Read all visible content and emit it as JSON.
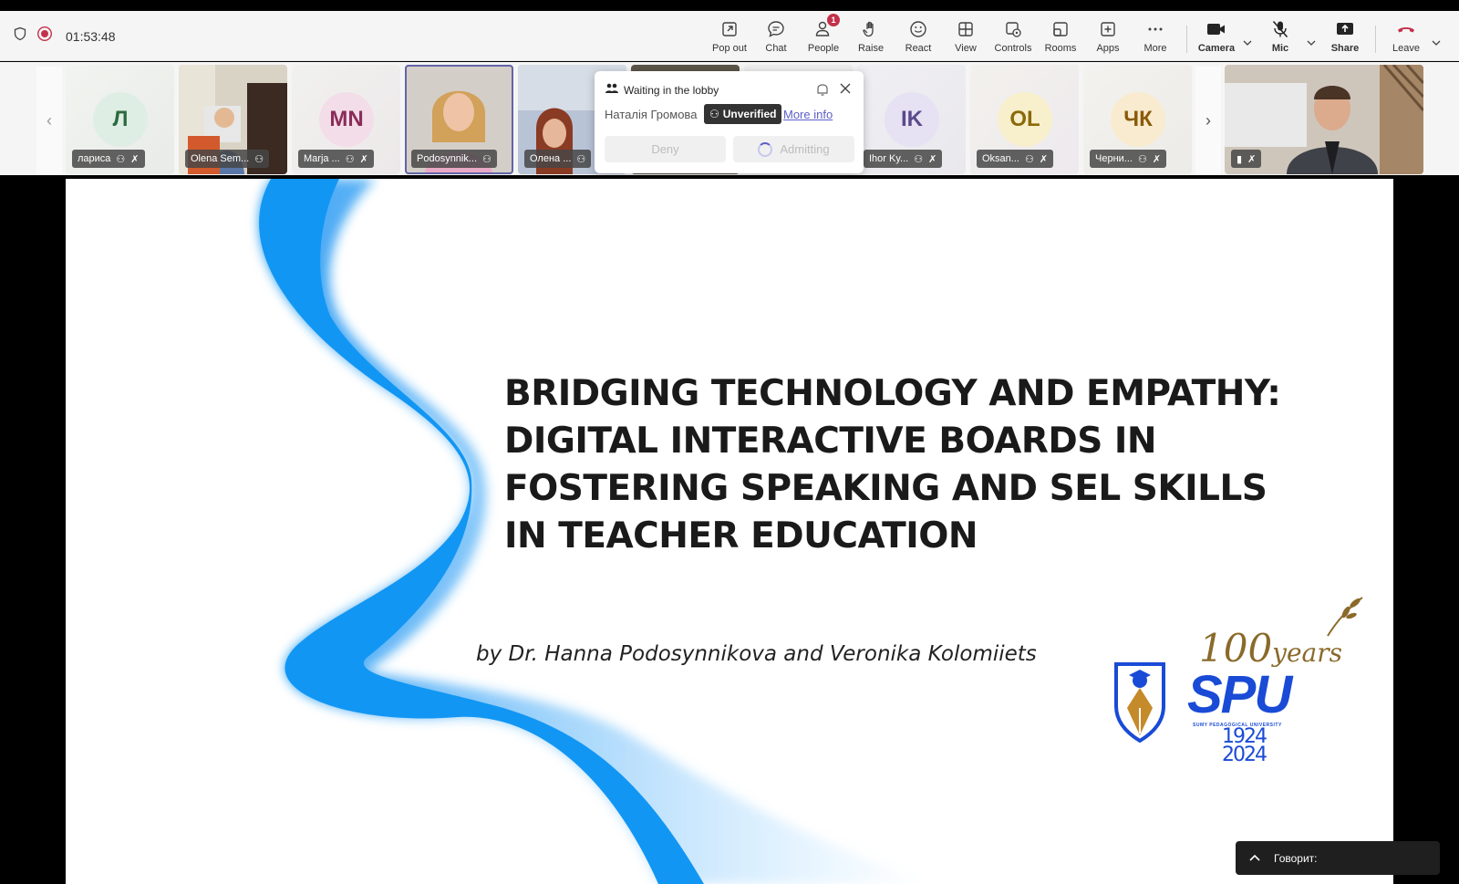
{
  "meeting": {
    "timer": "01:53:48"
  },
  "toolbar": {
    "popout": "Pop out",
    "chat": "Chat",
    "people": "People",
    "people_badge": "1",
    "raise": "Raise",
    "react": "React",
    "view": "View",
    "controls": "Controls",
    "rooms": "Rooms",
    "apps": "Apps",
    "more": "More",
    "camera": "Camera",
    "mic": "Mic",
    "share": "Share",
    "leave": "Leave"
  },
  "participants": [
    {
      "initials": "Л",
      "name": "лариса",
      "avatar_bg": "#dfeee4",
      "avatar_fg": "#2b6a3f"
    },
    {
      "name": "Olena Sem..."
    },
    {
      "initials": "MN",
      "name": "Marja ...",
      "avatar_bg": "#f3dde8",
      "avatar_fg": "#8a2d59"
    },
    {
      "name": "Podosynnik..."
    },
    {
      "name": "Олена ..."
    },
    {
      "initials": "IK",
      "name": "Ihor Ky...",
      "avatar_bg": "#e6e1f3",
      "avatar_fg": "#5a4a8a"
    },
    {
      "initials": "OL",
      "name": "Oksan...",
      "avatar_bg": "#f8efcc",
      "avatar_fg": "#8a6a0a"
    },
    {
      "initials": "ЧК",
      "name": "Черни...",
      "avatar_bg": "#f8ebcf",
      "avatar_fg": "#8a5a0a"
    }
  ],
  "lobby": {
    "title": "Waiting in the lobby",
    "name": "Наталія Громова",
    "badge": "Unverified",
    "more_info": "More info",
    "deny": "Deny",
    "admitting": "Admitting"
  },
  "slide": {
    "title_lines": [
      "BRIDGING TECHNOLOGY AND EMPATHY:",
      "DIGITAL INTERACTIVE BOARDS IN",
      "FOSTERING SPEAKING AND SEL SKILLS",
      "IN TEACHER EDUCATION"
    ],
    "authors": "by Dr. Hanna Podosynnikova and Veronika Kolomiiets",
    "logo_years_num": "100",
    "logo_years_word": "years",
    "logo_spu": "SPU",
    "logo_subtitle": "SUMY PEDAGOGICAL UNIVERSITY",
    "logo_year_start": "1924",
    "logo_year_end": "2024"
  },
  "speaking": {
    "label": "Говорит:"
  },
  "colors": {
    "accent": "#6264a7",
    "leave": "#c4314b",
    "recording": "#c4314b"
  }
}
